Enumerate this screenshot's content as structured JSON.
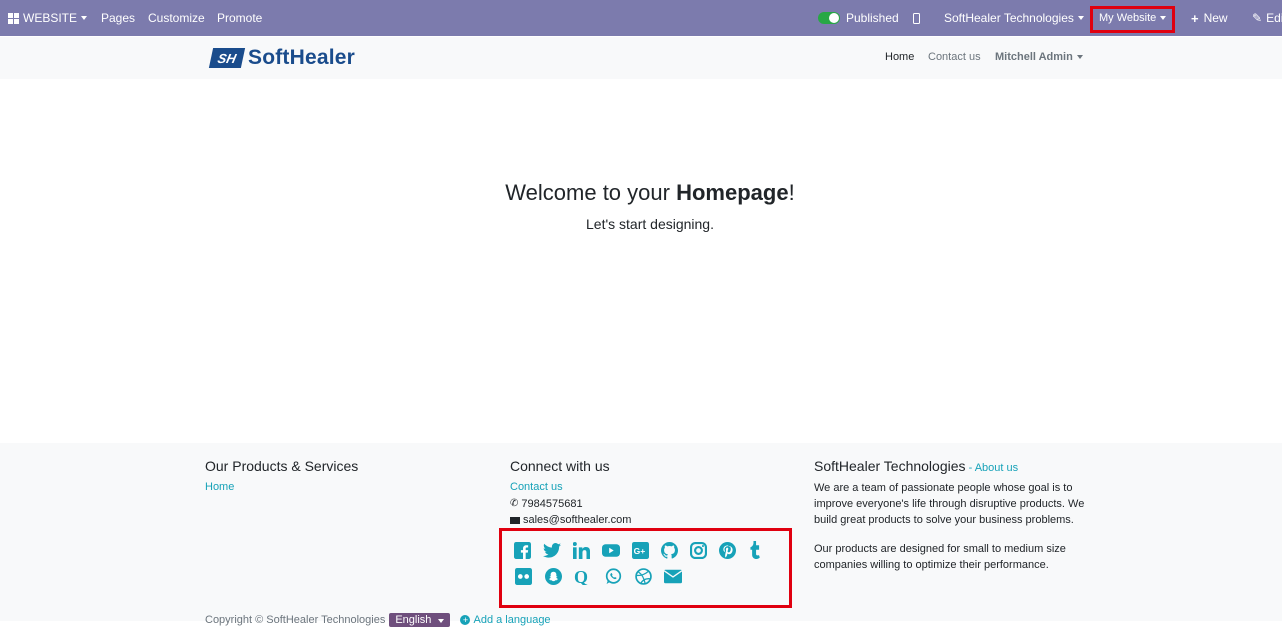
{
  "topbar": {
    "website": "WEBSITE",
    "pages": "Pages",
    "customize": "Customize",
    "promote": "Promote",
    "published": "Published",
    "company": "SoftHealer Technologies",
    "my_website": "My Website",
    "new": "New",
    "edit": "Edit"
  },
  "brand": {
    "mark": "SH",
    "text": "SoftHealer",
    "color": "#1a4c8c"
  },
  "nav": {
    "home": "Home",
    "contact": "Contact us",
    "user": "Mitchell Admin"
  },
  "hero": {
    "prefix": "Welcome to your ",
    "bold": "Homepage",
    "suffix": "!",
    "subtitle": "Let's start designing."
  },
  "footer": {
    "col1": {
      "title": "Our Products & Services",
      "link": "Home"
    },
    "col2": {
      "title": "Connect with us",
      "contact": "Contact us",
      "phone": "7984575681",
      "email": "sales@softhealer.com"
    },
    "col3": {
      "title": "SoftHealer Technologies",
      "about_sep": " - ",
      "about": "About us",
      "para1": "We are a team of passionate people whose goal is to improve everyone's life through disruptive products. We build great products to solve your business problems.",
      "para2": "Our products are designed for small to medium size companies willing to optimize their performance."
    },
    "social_icons_row1": [
      "facebook-icon",
      "twitter-icon",
      "linkedin-icon",
      "youtube-icon",
      "google-plus-icon",
      "github-icon",
      "instagram-icon",
      "pinterest-icon",
      "tumblr-icon"
    ],
    "social_icons_row2": [
      "flickr-icon",
      "snapchat-icon",
      "quora-icon",
      "whatsapp-icon",
      "dribbble-icon",
      "envelope-icon"
    ],
    "copyright": "Copyright © SoftHealer Technologies",
    "language": "English",
    "add_language": "Add a language"
  },
  "colors": {
    "topbar": "#7c7bad",
    "accent": "#17a2b8",
    "highlight": "#e0000f"
  }
}
